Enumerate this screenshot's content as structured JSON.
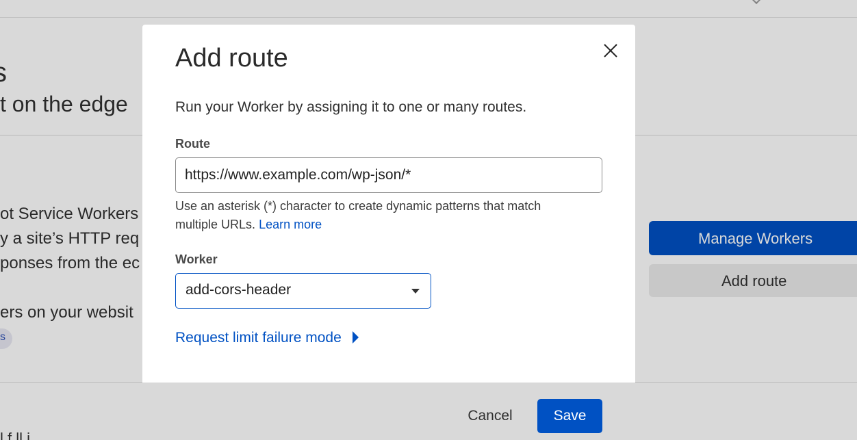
{
  "background": {
    "title_fragment": "s",
    "subtitle_fragment": "t on the edge",
    "intro_lines": [
      "ot Service Workers",
      "y a site’s HTTP req",
      "ponses from the ec"
    ],
    "workers_line": "ers on your websit",
    "pill_text": "s",
    "manage_workers_label": "Manage Workers",
    "add_route_label": "Add route",
    "bottom_fragment": "l f        ll    i"
  },
  "modal": {
    "title": "Add route",
    "description": "Run your Worker by assigning it to one or many routes.",
    "route": {
      "label": "Route",
      "value": "https://www.example.com/wp-json/*",
      "help_text": "Use an asterisk (*) character to create dynamic patterns that match multiple URLs.",
      "help_link": "Learn more"
    },
    "worker": {
      "label": "Worker",
      "selected": "add-cors-header"
    },
    "request_limit_label": "Request limit failure mode",
    "footer": {
      "cancel_label": "Cancel",
      "save_label": "Save"
    }
  },
  "colors": {
    "primary": "#0051c3",
    "footer_bg": "#d9d9d9",
    "text": "#313131"
  },
  "icons": {
    "close": "close-icon",
    "select_caret": "chevron-down-icon",
    "disclosure_caret": "caret-right-icon"
  }
}
